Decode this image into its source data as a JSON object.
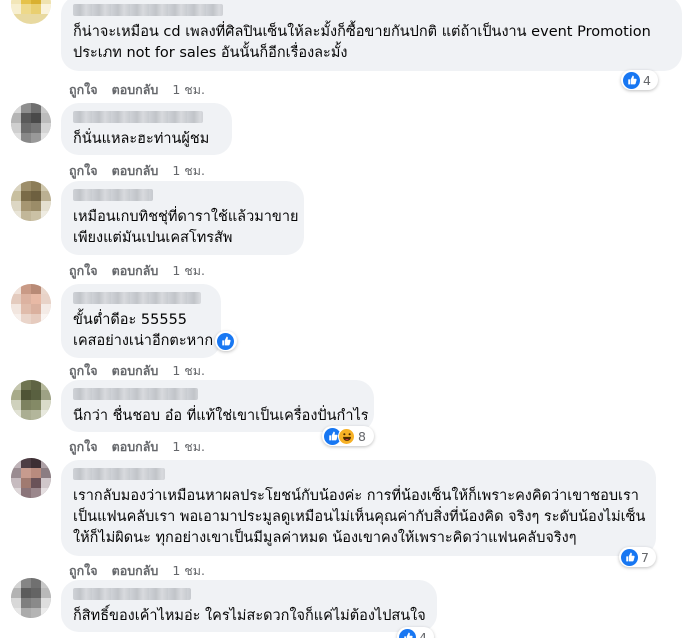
{
  "labels": {
    "like": "ถูกใจ",
    "reply": "ตอบกลับ",
    "time": "1 ชม."
  },
  "colors": {
    "bubble": "#f0f2f5",
    "meta": "#65676b",
    "like_blue": "#1877f2",
    "haha_yellow": "#f7b125"
  },
  "comments": [
    {
      "lines": [
        "ก็น่าจะเหมือน cd เพลงที่ศิลปินเซ็นให้ละมั้งก็ซื้อขายกันปกติ แต่ถ้าเป็นงาน event Promotion",
        "ประเภท not for sales อันนั้นก็อีกเรื่องละมั้ง"
      ],
      "reaction_count": "4",
      "reactions": [
        "like-icon"
      ]
    },
    {
      "lines": [
        "ก็นั่นแหละฮะท่านผู้ชม"
      ]
    },
    {
      "lines": [
        "เหมือนเกบทิชชุ่ที่ดาราใช้แล้วมาขาย",
        "เพียงแต่มันเปนเคสโทรสัพ"
      ]
    },
    {
      "lines": [
        "ขั้นต่ำดีอะ 55555",
        "เคสอย่างเน่าอีกตะหาก"
      ],
      "reaction_count": "",
      "reactions": [
        "like-icon"
      ]
    },
    {
      "lines": [
        "นีกว่า ชื่นชอบ อ๋อ ที่แท้ใช่เขาเป็นเครื่องปั่นกำไร"
      ],
      "reaction_count": "8",
      "reactions": [
        "like-icon",
        "haha-icon"
      ]
    },
    {
      "lines": [
        "เรากลับมองว่าเหมือนหาผลประโยชน์กับน้องค่ะ การที่น้องเซ็นให้ก็เพราะคงคิดว่าเขาชอบเรา",
        "เป็นแฟนคลับเรา พอเอามาประมูลดูเหมือนไม่เห็นคุณค่ากับสิ่งที่น้องคิด จริงๆ ระดับน้องไม่เซ็น",
        "ให้ก็ไม่ผิดนะ ทุกอย่างเขาเป็นมีมูลค่าหมด น้องเขาคงให้เพราะคิดว่าแฟนคลับจริงๆ"
      ],
      "reaction_count": "7",
      "reactions": [
        "like-icon"
      ]
    },
    {
      "lines": [
        "ก็สิทธิ์ของเค้าไหมอ่ะ ใครไม่สะดวกใจก็แค่ไม่ต้องไปสนใจ"
      ],
      "reaction_count": "4",
      "reactions": [
        "like-icon"
      ]
    }
  ]
}
